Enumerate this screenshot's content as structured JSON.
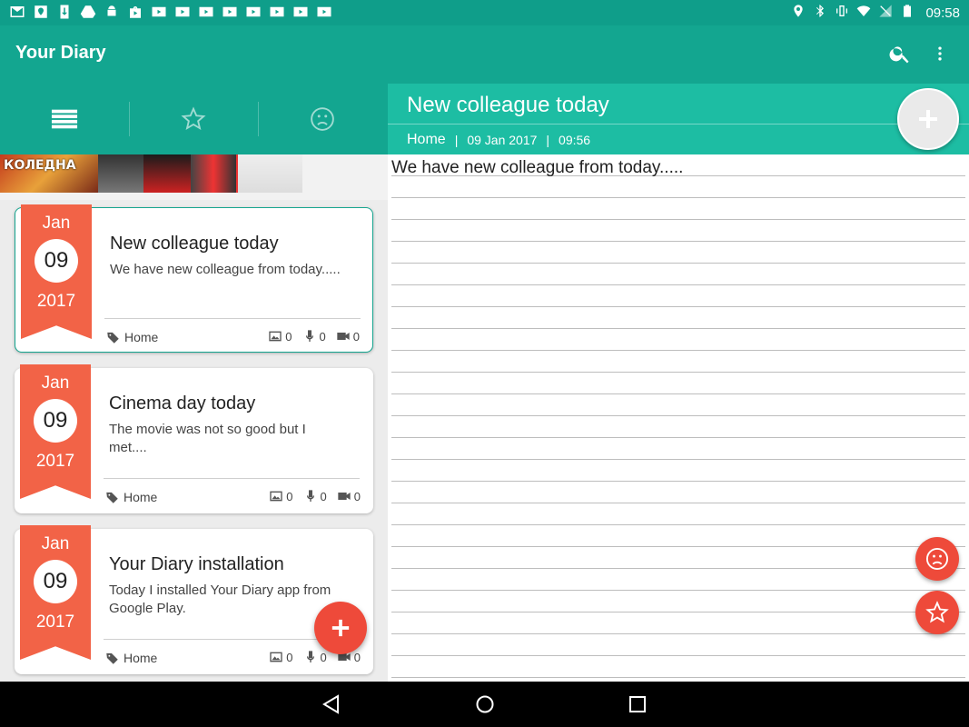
{
  "status_bar": {
    "time": "09:58"
  },
  "app": {
    "title": "Your Diary"
  },
  "ad": {
    "text": "КОЛЕДНА"
  },
  "entries": [
    {
      "month": "Jan",
      "day": "09",
      "year": "2017",
      "title": "New colleague today",
      "text": "We have new colleague from today.....",
      "tag": "Home",
      "images": "0",
      "audio": "0",
      "video": "0"
    },
    {
      "month": "Jan",
      "day": "09",
      "year": "2017",
      "title": "Cinema day today",
      "text": "The movie was not so good but I met....",
      "tag": "Home",
      "images": "0",
      "audio": "0",
      "video": "0"
    },
    {
      "month": "Jan",
      "day": "09",
      "year": "2017",
      "title": "Your Diary installation",
      "text": "Today I installed Your Diary app from Google Play.",
      "tag": "Home",
      "images": "0",
      "audio": "0",
      "video": "0"
    }
  ],
  "detail": {
    "title": "New colleague today",
    "tag": "Home",
    "separator": "|",
    "date": "09 Jan 2017",
    "time": "09:56",
    "text": "We have new colleague from today....."
  },
  "colors": {
    "primary": "#13a690",
    "primary_dark": "#0f9e8a",
    "detail_header": "#1dbda3",
    "accent": "#ee4a3a",
    "ribbon": "#f26347"
  }
}
